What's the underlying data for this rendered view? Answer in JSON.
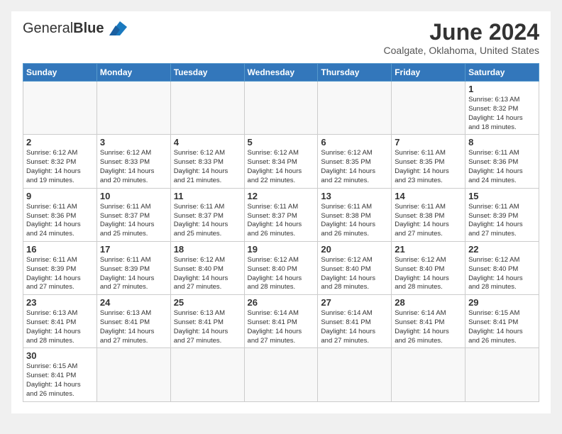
{
  "header": {
    "logo_text_normal": "General",
    "logo_text_bold": "Blue",
    "month_title": "June 2024",
    "location": "Coalgate, Oklahoma, United States"
  },
  "weekdays": [
    "Sunday",
    "Monday",
    "Tuesday",
    "Wednesday",
    "Thursday",
    "Friday",
    "Saturday"
  ],
  "weeks": [
    [
      {
        "day": "",
        "info": ""
      },
      {
        "day": "",
        "info": ""
      },
      {
        "day": "",
        "info": ""
      },
      {
        "day": "",
        "info": ""
      },
      {
        "day": "",
        "info": ""
      },
      {
        "day": "",
        "info": ""
      },
      {
        "day": "1",
        "info": "Sunrise: 6:13 AM\nSunset: 8:32 PM\nDaylight: 14 hours and 18 minutes."
      }
    ],
    [
      {
        "day": "2",
        "info": "Sunrise: 6:12 AM\nSunset: 8:32 PM\nDaylight: 14 hours and 19 minutes."
      },
      {
        "day": "3",
        "info": "Sunrise: 6:12 AM\nSunset: 8:33 PM\nDaylight: 14 hours and 20 minutes."
      },
      {
        "day": "4",
        "info": "Sunrise: 6:12 AM\nSunset: 8:33 PM\nDaylight: 14 hours and 21 minutes."
      },
      {
        "day": "5",
        "info": "Sunrise: 6:12 AM\nSunset: 8:34 PM\nDaylight: 14 hours and 22 minutes."
      },
      {
        "day": "6",
        "info": "Sunrise: 6:12 AM\nSunset: 8:35 PM\nDaylight: 14 hours and 22 minutes."
      },
      {
        "day": "7",
        "info": "Sunrise: 6:11 AM\nSunset: 8:35 PM\nDaylight: 14 hours and 23 minutes."
      },
      {
        "day": "8",
        "info": "Sunrise: 6:11 AM\nSunset: 8:36 PM\nDaylight: 14 hours and 24 minutes."
      }
    ],
    [
      {
        "day": "9",
        "info": "Sunrise: 6:11 AM\nSunset: 8:36 PM\nDaylight: 14 hours and 24 minutes."
      },
      {
        "day": "10",
        "info": "Sunrise: 6:11 AM\nSunset: 8:37 PM\nDaylight: 14 hours and 25 minutes."
      },
      {
        "day": "11",
        "info": "Sunrise: 6:11 AM\nSunset: 8:37 PM\nDaylight: 14 hours and 25 minutes."
      },
      {
        "day": "12",
        "info": "Sunrise: 6:11 AM\nSunset: 8:37 PM\nDaylight: 14 hours and 26 minutes."
      },
      {
        "day": "13",
        "info": "Sunrise: 6:11 AM\nSunset: 8:38 PM\nDaylight: 14 hours and 26 minutes."
      },
      {
        "day": "14",
        "info": "Sunrise: 6:11 AM\nSunset: 8:38 PM\nDaylight: 14 hours and 27 minutes."
      },
      {
        "day": "15",
        "info": "Sunrise: 6:11 AM\nSunset: 8:39 PM\nDaylight: 14 hours and 27 minutes."
      }
    ],
    [
      {
        "day": "16",
        "info": "Sunrise: 6:11 AM\nSunset: 8:39 PM\nDaylight: 14 hours and 27 minutes."
      },
      {
        "day": "17",
        "info": "Sunrise: 6:11 AM\nSunset: 8:39 PM\nDaylight: 14 hours and 27 minutes."
      },
      {
        "day": "18",
        "info": "Sunrise: 6:12 AM\nSunset: 8:40 PM\nDaylight: 14 hours and 27 minutes."
      },
      {
        "day": "19",
        "info": "Sunrise: 6:12 AM\nSunset: 8:40 PM\nDaylight: 14 hours and 28 minutes."
      },
      {
        "day": "20",
        "info": "Sunrise: 6:12 AM\nSunset: 8:40 PM\nDaylight: 14 hours and 28 minutes."
      },
      {
        "day": "21",
        "info": "Sunrise: 6:12 AM\nSunset: 8:40 PM\nDaylight: 14 hours and 28 minutes."
      },
      {
        "day": "22",
        "info": "Sunrise: 6:12 AM\nSunset: 8:40 PM\nDaylight: 14 hours and 28 minutes."
      }
    ],
    [
      {
        "day": "23",
        "info": "Sunrise: 6:13 AM\nSunset: 8:41 PM\nDaylight: 14 hours and 28 minutes."
      },
      {
        "day": "24",
        "info": "Sunrise: 6:13 AM\nSunset: 8:41 PM\nDaylight: 14 hours and 27 minutes."
      },
      {
        "day": "25",
        "info": "Sunrise: 6:13 AM\nSunset: 8:41 PM\nDaylight: 14 hours and 27 minutes."
      },
      {
        "day": "26",
        "info": "Sunrise: 6:14 AM\nSunset: 8:41 PM\nDaylight: 14 hours and 27 minutes."
      },
      {
        "day": "27",
        "info": "Sunrise: 6:14 AM\nSunset: 8:41 PM\nDaylight: 14 hours and 27 minutes."
      },
      {
        "day": "28",
        "info": "Sunrise: 6:14 AM\nSunset: 8:41 PM\nDaylight: 14 hours and 26 minutes."
      },
      {
        "day": "29",
        "info": "Sunrise: 6:15 AM\nSunset: 8:41 PM\nDaylight: 14 hours and 26 minutes."
      }
    ],
    [
      {
        "day": "30",
        "info": "Sunrise: 6:15 AM\nSunset: 8:41 PM\nDaylight: 14 hours and 26 minutes."
      },
      {
        "day": "",
        "info": ""
      },
      {
        "day": "",
        "info": ""
      },
      {
        "day": "",
        "info": ""
      },
      {
        "day": "",
        "info": ""
      },
      {
        "day": "",
        "info": ""
      },
      {
        "day": "",
        "info": ""
      }
    ]
  ]
}
